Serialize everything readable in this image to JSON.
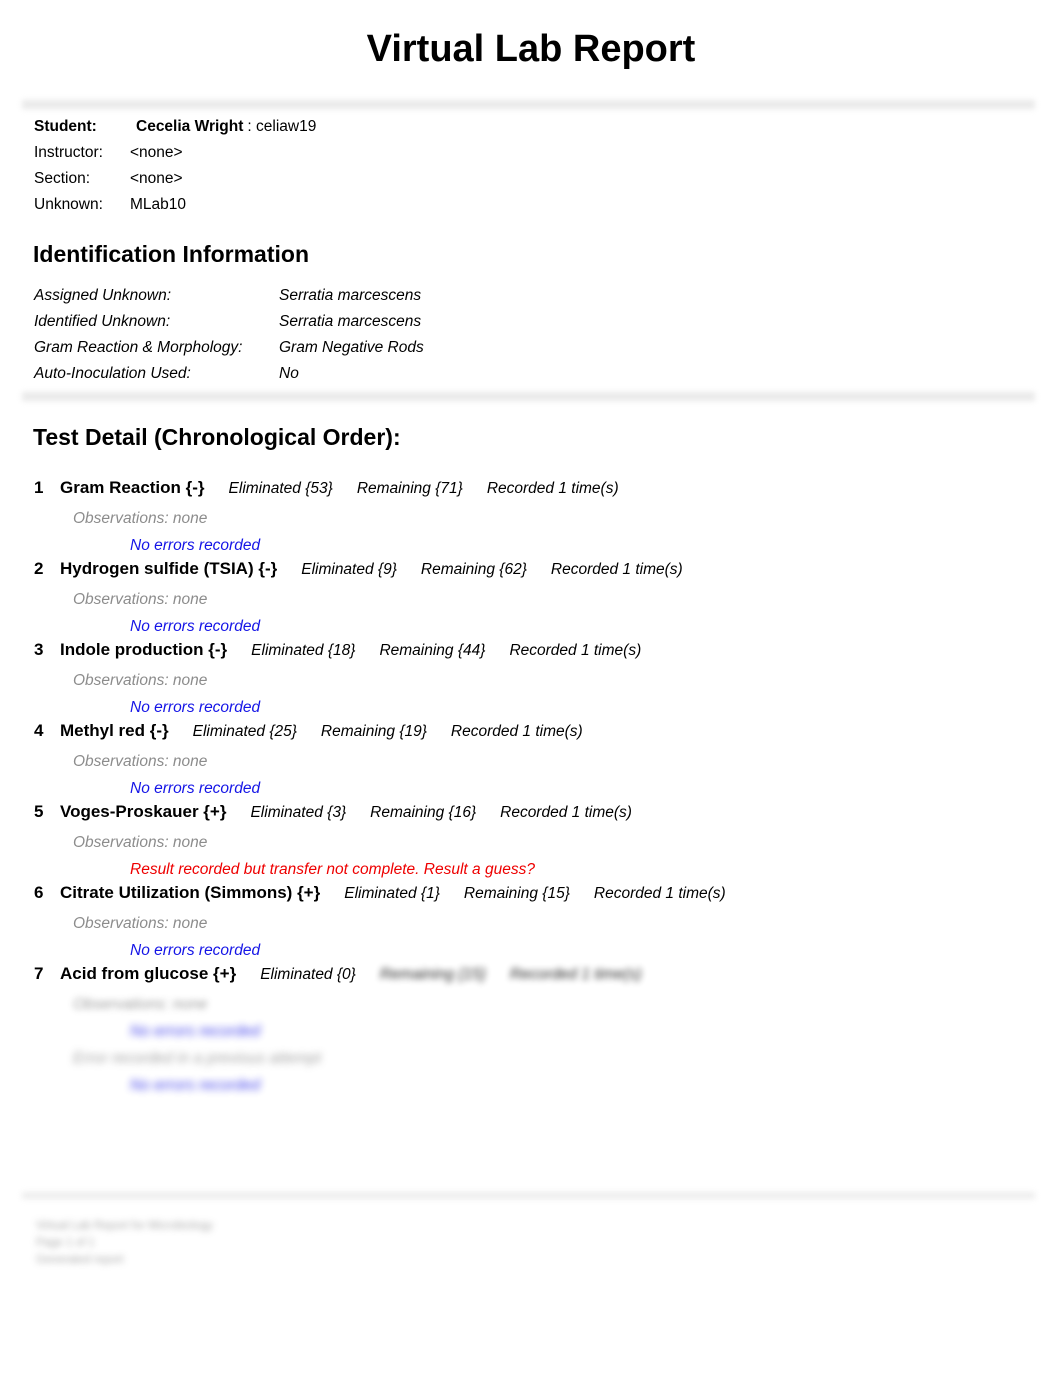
{
  "document": {
    "title": "Virtual Lab Report"
  },
  "meta": {
    "rows": [
      {
        "label": "Student:",
        "value": "Cecelia Wright",
        "suffix": ": celiaw19",
        "bold": true
      },
      {
        "label": "Instructor:",
        "value": "<none>",
        "suffix": "",
        "bold": false
      },
      {
        "label": "Section:",
        "value": "<none>",
        "suffix": "",
        "bold": false
      },
      {
        "label": "Unknown:",
        "value": "MLab10",
        "suffix": "",
        "bold": false
      }
    ]
  },
  "identification": {
    "heading": "Identification Information",
    "rows": [
      {
        "label": "Assigned Unknown:",
        "value": "Serratia marcescens"
      },
      {
        "label": "Identified Unknown:",
        "value": "Serratia marcescens"
      },
      {
        "label": "Gram Reaction & Morphology:",
        "value": "Gram Negative Rods"
      },
      {
        "label": "Auto-Inoculation Used:",
        "value": "No"
      }
    ]
  },
  "tests_section": {
    "heading": "Test Detail (Chronological Order):",
    "tests": [
      {
        "num": "1",
        "title": "Gram Reaction {-}",
        "eliminated": "Eliminated {53}",
        "remaining": "Remaining {71}",
        "recorded": "Recorded 1 time(s)",
        "observations": "Observations: none",
        "note": "No errors recorded",
        "note_type": "ok"
      },
      {
        "num": "2",
        "title": "Hydrogen sulfide (TSIA) {-}",
        "eliminated": "Eliminated {9}",
        "remaining": "Remaining {62}",
        "recorded": "Recorded 1 time(s)",
        "observations": "Observations: none",
        "note": "No errors recorded",
        "note_type": "ok"
      },
      {
        "num": "3",
        "title": "Indole production {-}",
        "eliminated": "Eliminated {18}",
        "remaining": "Remaining {44}",
        "recorded": "Recorded 1 time(s)",
        "observations": "Observations: none",
        "note": "No errors recorded",
        "note_type": "ok"
      },
      {
        "num": "4",
        "title": "Methyl red {-}",
        "eliminated": "Eliminated {25}",
        "remaining": "Remaining {19}",
        "recorded": "Recorded 1 time(s)",
        "observations": "Observations: none",
        "note": "No errors recorded",
        "note_type": "ok"
      },
      {
        "num": "5",
        "title": "Voges-Proskauer {+}",
        "eliminated": "Eliminated {3}",
        "remaining": "Remaining {16}",
        "recorded": "Recorded 1 time(s)",
        "observations": "Observations: none",
        "note": "Result recorded but transfer not complete. Result a guess?",
        "note_type": "error"
      },
      {
        "num": "6",
        "title": "Citrate Utilization (Simmons) {+}",
        "eliminated": "Eliminated {1}",
        "remaining": "Remaining {15}",
        "recorded": "Recorded 1 time(s)",
        "observations": "Observations: none",
        "note": "No errors recorded",
        "note_type": "ok"
      },
      {
        "num": "7",
        "title": "Acid from glucose {+}",
        "eliminated": "Eliminated {0}",
        "remaining": "Remaining {15}",
        "recorded": "Recorded 1 time(s)",
        "observations": "Observations: none",
        "note": "No errors recorded",
        "note_type": "ok"
      }
    ],
    "tail_lines": [
      {
        "text": "No errors recorded",
        "type": "ok"
      },
      {
        "text": "Error recorded in a previous attempt",
        "type": "obs"
      },
      {
        "text": "No errors recorded",
        "type": "ok"
      }
    ]
  },
  "footer": {
    "lines": [
      "Virtual Lab Report for Microbiology",
      "Page 1 of 1",
      "Generated report"
    ]
  },
  "colors": {
    "note_ok": "#1414e6",
    "note_error": "#ee0000",
    "observation": "#8c8c8c",
    "divider": "#e9e9e9"
  }
}
